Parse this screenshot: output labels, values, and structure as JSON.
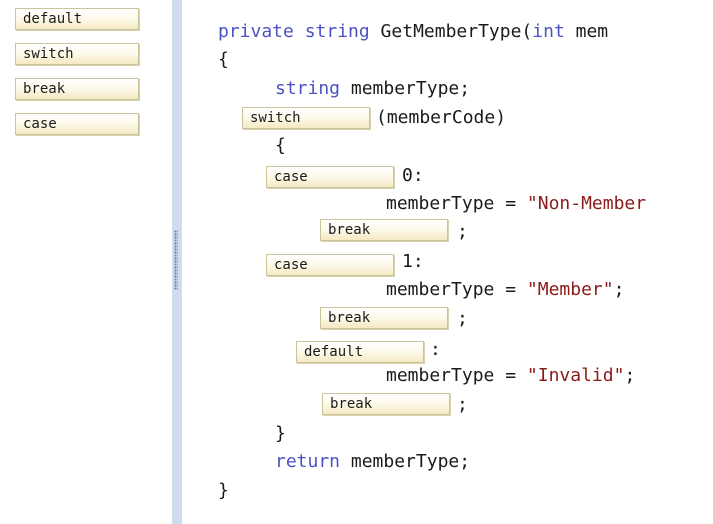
{
  "palette": {
    "items": [
      "default",
      "switch",
      "break",
      "case"
    ]
  },
  "code": {
    "line1_kw": "private string",
    "line1_text": " GetMemberType(",
    "line1_kw2": "int",
    "line1_text2": " mem",
    "open_brace": "{",
    "decl_kw": "string",
    "decl_text": " memberType;",
    "switch_slot": "switch",
    "switch_text": "(memberCode)",
    "inner_open": "{",
    "case1_slot": "case",
    "case1_text": "0:",
    "assign1_text": "memberType = ",
    "assign1_str": "\"Non-Member",
    "break1_slot": "break",
    "semi1": ";",
    "case2_slot": "case",
    "case2_text": "1:",
    "assign2_text": "memberType = ",
    "assign2_str": "\"Member\"",
    "assign2_end": ";",
    "default_slot": "default",
    "default_text": ":",
    "break2_slot": "break",
    "semi2": ";",
    "assign3_text": "memberType = ",
    "assign3_str": "\"Invalid\"",
    "assign3_end": ";",
    "break3_slot": "break",
    "semi3": ";",
    "inner_close": "}",
    "return_kw": "return",
    "return_text": " memberType;",
    "close_brace": "}"
  },
  "colors": {
    "keyword": "#4b52c4",
    "string": "#8b1a1a",
    "splitter": "#cfdcee",
    "token_border": "#c9c49c"
  }
}
